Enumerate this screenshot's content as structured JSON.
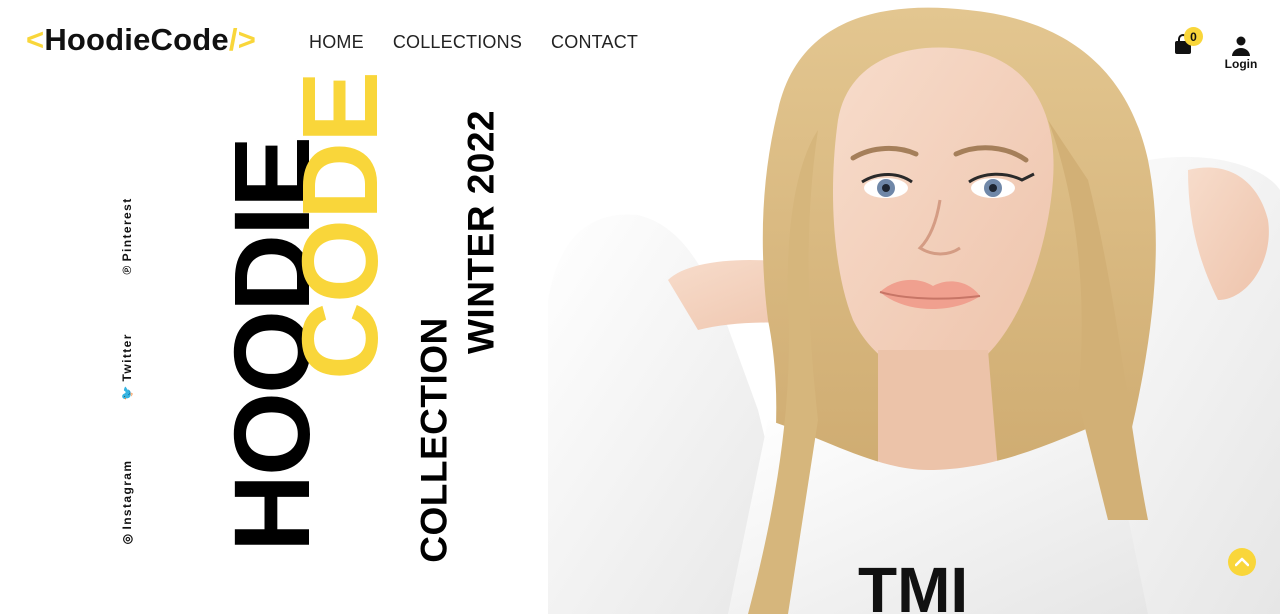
{
  "brand": {
    "open": "<",
    "name": "HoodieCode",
    "close": "/>"
  },
  "nav": {
    "home": "HOME",
    "collections": "COLLECTIONS",
    "contact": "CONTACT"
  },
  "cart": {
    "count": "0",
    "icon": "shopping-bag-icon"
  },
  "account": {
    "login_label": "Login",
    "icon": "user-icon"
  },
  "social": {
    "pinterest": "Pinterest",
    "twitter": "Twitter",
    "instagram": "Instagram"
  },
  "hero": {
    "word_1": "HOODIE",
    "word_2": "CODE",
    "collection_label": "COLLECTION",
    "season_label": "WINTER 2022",
    "shirt_print": "TMI"
  },
  "colors": {
    "accent": "#f9d63a",
    "text": "#111111",
    "background": "#ffffff"
  },
  "scroll_top": {
    "icon": "chevron-up-icon"
  }
}
